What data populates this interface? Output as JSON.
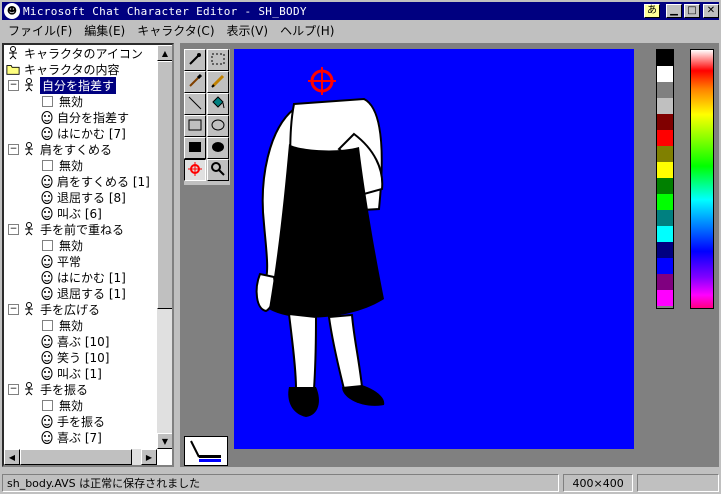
{
  "window": {
    "title": "Microsoft Chat Character Editor - SH_BODY",
    "app_icon": "chat-face-icon",
    "buttons": [
      "ime-indicator",
      "minimize",
      "maximize",
      "close"
    ],
    "ime_label": "あ"
  },
  "menubar": {
    "items": [
      "ファイル(F)",
      "編集(E)",
      "キャラクタ(C)",
      "表示(V)",
      "ヘルプ(H)"
    ]
  },
  "tree": {
    "nodes": [
      {
        "depth": 0,
        "icon": "figure",
        "label": "キャラクタのアイコン",
        "toggle": ""
      },
      {
        "depth": 0,
        "icon": "folder",
        "label": "キャラクタの内容",
        "toggle": ""
      },
      {
        "depth": 1,
        "icon": "figure",
        "label": "自分を指差す",
        "toggle": "−",
        "selected": true
      },
      {
        "depth": 2,
        "icon": "check",
        "label": "無効"
      },
      {
        "depth": 2,
        "icon": "face",
        "label": "自分を指差す"
      },
      {
        "depth": 2,
        "icon": "face",
        "label": "はにかむ [7]"
      },
      {
        "depth": 1,
        "icon": "figure",
        "label": "肩をすくめる",
        "toggle": "−"
      },
      {
        "depth": 2,
        "icon": "check",
        "label": "無効"
      },
      {
        "depth": 2,
        "icon": "face",
        "label": "肩をすくめる [1]"
      },
      {
        "depth": 2,
        "icon": "face",
        "label": "退屈する [8]"
      },
      {
        "depth": 2,
        "icon": "face",
        "label": "叫ぶ [6]"
      },
      {
        "depth": 1,
        "icon": "figure",
        "label": "手を前で重ねる",
        "toggle": "−"
      },
      {
        "depth": 2,
        "icon": "check",
        "label": "無効"
      },
      {
        "depth": 2,
        "icon": "face",
        "label": "平常"
      },
      {
        "depth": 2,
        "icon": "face",
        "label": "はにかむ [1]"
      },
      {
        "depth": 2,
        "icon": "face",
        "label": "退屈する [1]"
      },
      {
        "depth": 1,
        "icon": "figure",
        "label": "手を広げる",
        "toggle": "−"
      },
      {
        "depth": 2,
        "icon": "check",
        "label": "無効"
      },
      {
        "depth": 2,
        "icon": "face",
        "label": "喜ぶ [10]"
      },
      {
        "depth": 2,
        "icon": "face",
        "label": "笑う [10]"
      },
      {
        "depth": 2,
        "icon": "face",
        "label": "叫ぶ [1]"
      },
      {
        "depth": 1,
        "icon": "figure",
        "label": "手を振る",
        "toggle": "−"
      },
      {
        "depth": 2,
        "icon": "check",
        "label": "無効"
      },
      {
        "depth": 2,
        "icon": "face",
        "label": "手を振る"
      },
      {
        "depth": 2,
        "icon": "face",
        "label": "喜ぶ [7]"
      }
    ]
  },
  "tools": [
    {
      "name": "eyedropper-tool",
      "glyph": "eyedropper"
    },
    {
      "name": "select-rect-tool",
      "glyph": "dotted-rect"
    },
    {
      "name": "brush-tool",
      "glyph": "brush"
    },
    {
      "name": "pencil-tool",
      "glyph": "pencil"
    },
    {
      "name": "line-tool",
      "glyph": "line"
    },
    {
      "name": "fill-tool",
      "glyph": "bucket"
    },
    {
      "name": "rect-tool",
      "glyph": "rect"
    },
    {
      "name": "ellipse-tool",
      "glyph": "ellipse"
    },
    {
      "name": "filled-rect-tool",
      "glyph": "filled-rect"
    },
    {
      "name": "filled-ellipse-tool",
      "glyph": "filled-ellipse"
    },
    {
      "name": "face-target-tool",
      "glyph": "crosshair",
      "active": true
    },
    {
      "name": "zoom-tool",
      "glyph": "magnifier"
    }
  ],
  "canvas": {
    "background": "#0000ff"
  },
  "palette": [
    "#000000",
    "#ffffff",
    "#808080",
    "#c0c0c0",
    "#800000",
    "#ff0000",
    "#808000",
    "#ffff00",
    "#008000",
    "#00ff00",
    "#008080",
    "#00ffff",
    "#000080",
    "#0000ff",
    "#800080",
    "#ff00ff"
  ],
  "status": {
    "message": "sh_body.AVS は正常に保存されました",
    "size": "400×400"
  }
}
